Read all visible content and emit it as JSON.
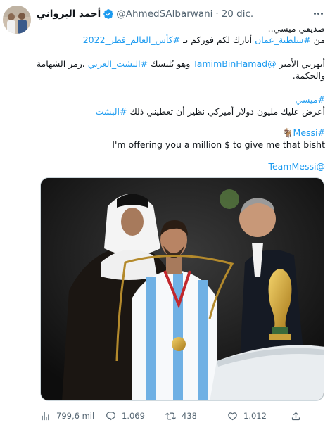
{
  "author": {
    "display_name": "أحمد البرواني",
    "handle": "@AhmedSAlbarwani",
    "separator": "·",
    "date": "20 dic."
  },
  "tweet": {
    "line1": "صديقي ميسي..",
    "line2_pre": "من ",
    "tag_oman": "#سلطنة_عمان",
    "line2_mid": " أبارك لكم فوزكم بـ ",
    "tag_worldcup": "#كأس_العالم_قطر_2022",
    "line3_pre": "أبهرني الأمير ",
    "mention_tamim": "@TamimBinHamad",
    "line3_mid": " وهو يُلبسك ",
    "tag_bisht_arabic": "#البشت_العربي",
    "line3_post": " ،رمز الشهامة",
    "line4": "والحكمة.",
    "tag_messi_ar": "#ميسي",
    "line6": "أعرض عليك مليون دولار أميركي نظير أن تعطيني ذلك ",
    "tag_bisht": "#البشت",
    "tag_messi_en": "#Messi",
    "emoji_goat": "🐐",
    "english_line": "I'm offering you a million $ to give me that bisht",
    "mention_teammessi": "@TeamMessi"
  },
  "actions": {
    "views": "799,6 mil",
    "replies": "1.069",
    "retweets": "438",
    "likes": "1.012"
  },
  "icons": {
    "verified": "verified-badge-icon",
    "more": "more-icon",
    "views": "views-chart-icon",
    "reply": "reply-icon",
    "retweet": "retweet-icon",
    "like": "heart-icon",
    "share": "share-icon"
  },
  "colors": {
    "link": "#1d9bf0",
    "secondary_text": "#536471",
    "primary_text": "#0f1419"
  }
}
